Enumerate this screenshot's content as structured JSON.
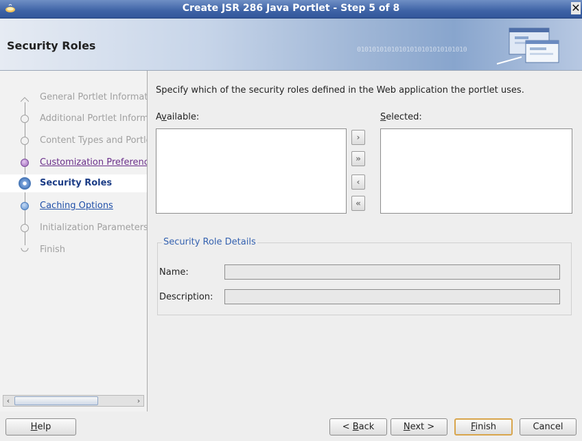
{
  "window": {
    "title": "Create JSR 286 Java Portlet - Step 5 of 8",
    "close_glyph": "✕"
  },
  "header": {
    "title": "Security Roles",
    "banner_binary": "01010101010101010101010101010"
  },
  "nav": {
    "items": [
      {
        "label": "General Portlet Information",
        "state": "disabled"
      },
      {
        "label": "Additional Portlet Information",
        "state": "disabled"
      },
      {
        "label": "Content Types and Portlet Modes",
        "state": "disabled"
      },
      {
        "label": "Customization Preferences",
        "state": "visited"
      },
      {
        "label": "Security Roles",
        "state": "current"
      },
      {
        "label": "Caching Options",
        "state": "link"
      },
      {
        "label": "Initialization Parameters",
        "state": "disabled"
      },
      {
        "label": "Finish",
        "state": "disabled"
      }
    ],
    "scroll_left": "‹",
    "scroll_right": "›"
  },
  "main": {
    "instructions": "Specify which of the security roles defined in the Web application the portlet uses.",
    "available_label_pre": "A",
    "available_label_mn": "v",
    "available_label_post": "ailable:",
    "selected_label_mn": "S",
    "selected_label_post": "elected:",
    "shuttle": {
      "move": "›",
      "move_all": "»",
      "remove": "‹",
      "remove_all": "«"
    },
    "details": {
      "legend": "Security Role Details",
      "name_label": "Name:",
      "name_value": "",
      "description_label": "Description:",
      "description_value": ""
    }
  },
  "buttons": {
    "help_mn": "H",
    "help_rest": "elp",
    "back_pre": "< ",
    "back_mn": "B",
    "back_rest": "ack",
    "next_mn": "N",
    "next_rest": "ext >",
    "finish_mn": "F",
    "finish_rest": "inish",
    "cancel": "Cancel"
  },
  "colors": {
    "title_bar": "#3e63a6",
    "current_step": "#1c3d86",
    "visited_link": "#6a2f8a",
    "link": "#1f4fa8",
    "group_legend": "#3562b0",
    "default_button_border": "#d8a54c"
  }
}
